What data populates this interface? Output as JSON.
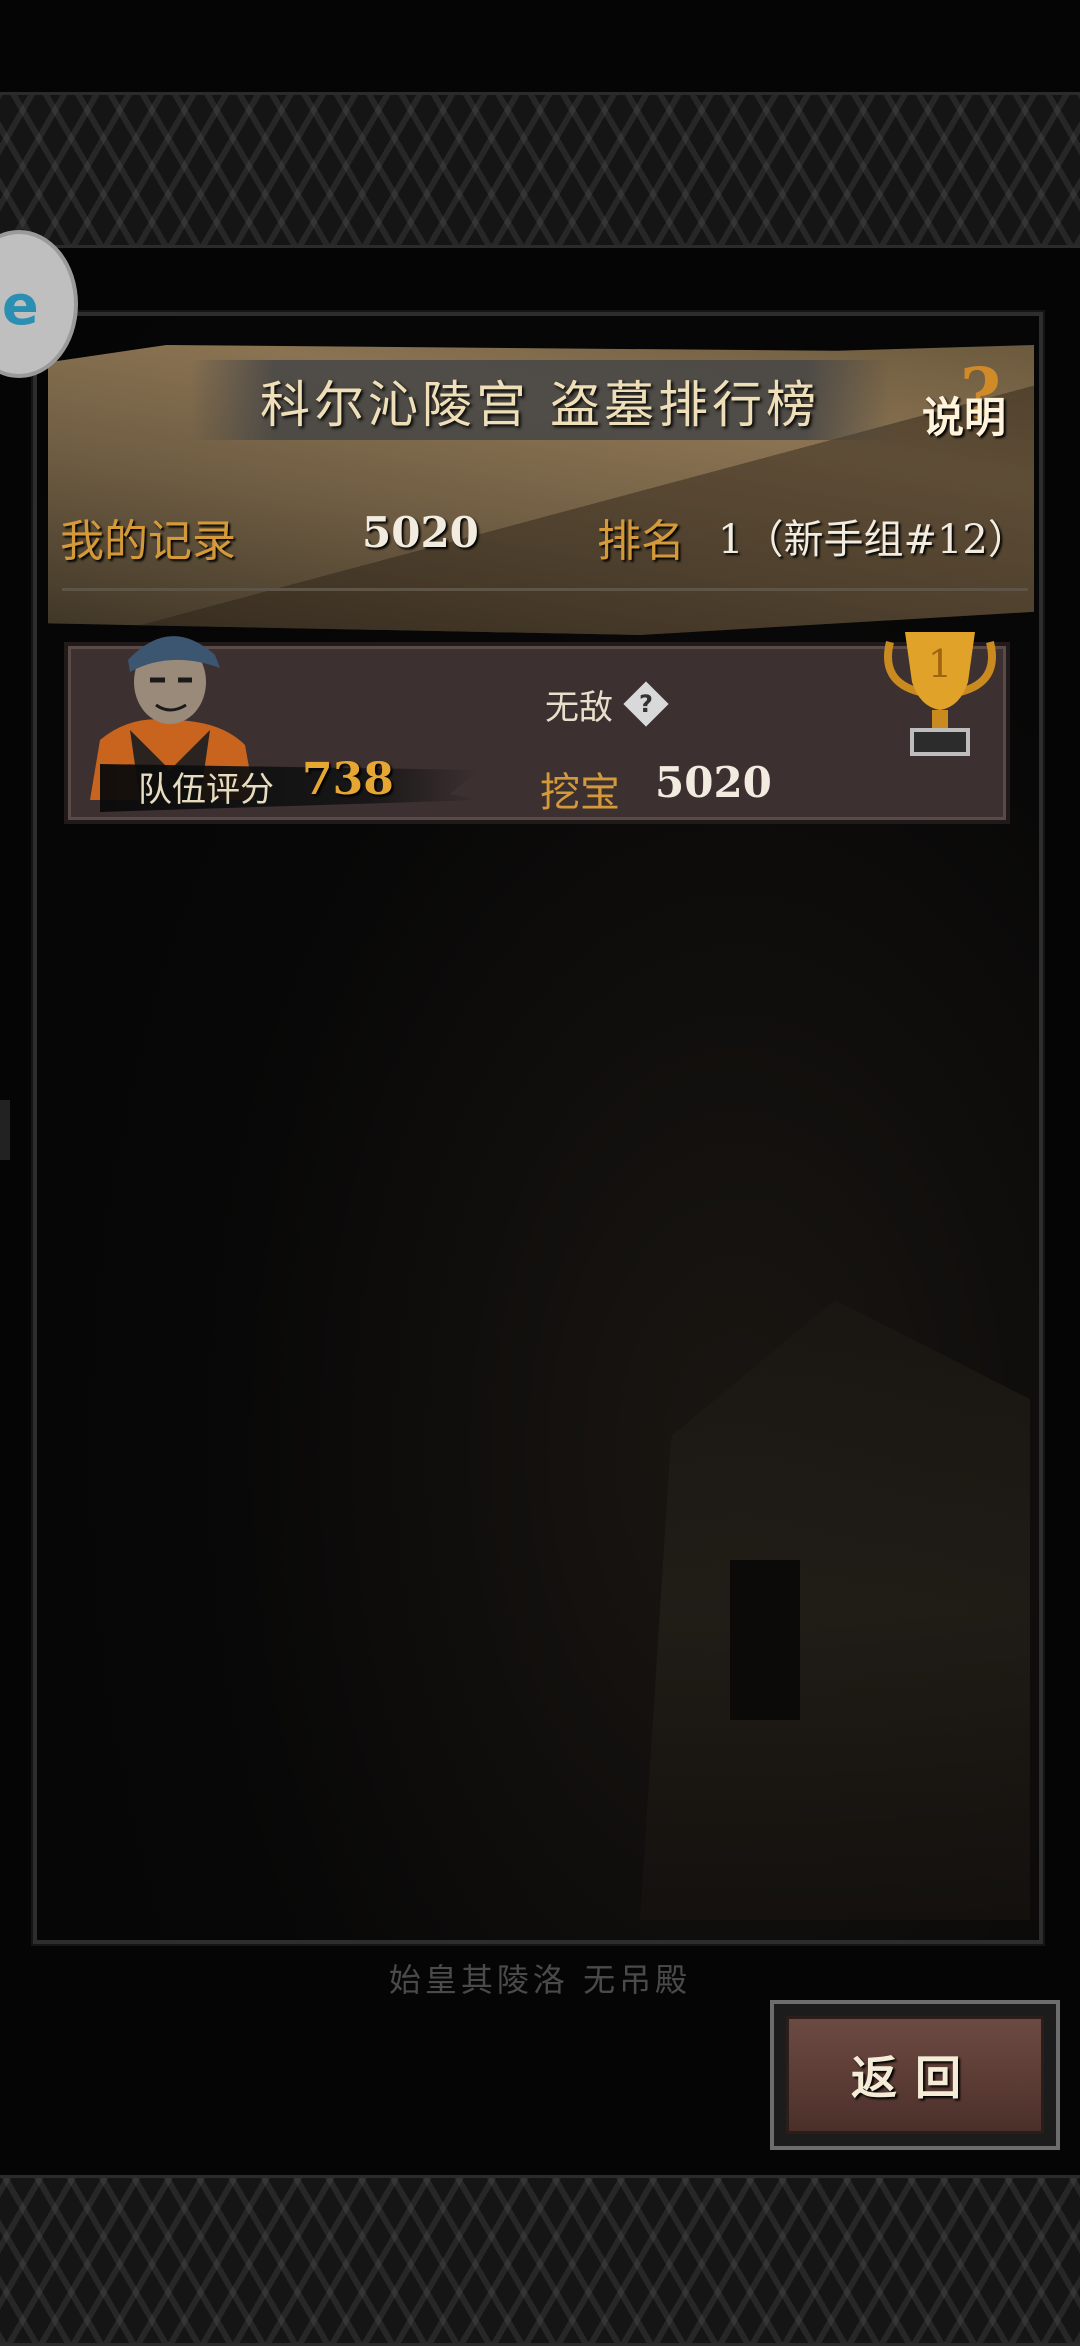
{
  "header": {
    "title": "科尔沁陵宫 盗墓排行榜",
    "help_label": "说明",
    "help_mark": "?"
  },
  "my_record": {
    "label": "我的记录",
    "value": "5020",
    "rank_label": "排名",
    "rank_value": "1（新手组#12）"
  },
  "leaderboard": [
    {
      "team_score_label": "队伍评分",
      "team_score": "738",
      "title": "无敌",
      "dig_label": "挖宝",
      "dig_value": "5020",
      "rank": "1"
    }
  ],
  "footer": {
    "caption": "始皇其陵洛 无吊殿",
    "back_label": "返回"
  },
  "floating_icon": {
    "text": "e"
  },
  "colors": {
    "accent_gold": "#d49a3a",
    "row_bg": "#3d3031",
    "button_bg": "#5a3b34"
  }
}
